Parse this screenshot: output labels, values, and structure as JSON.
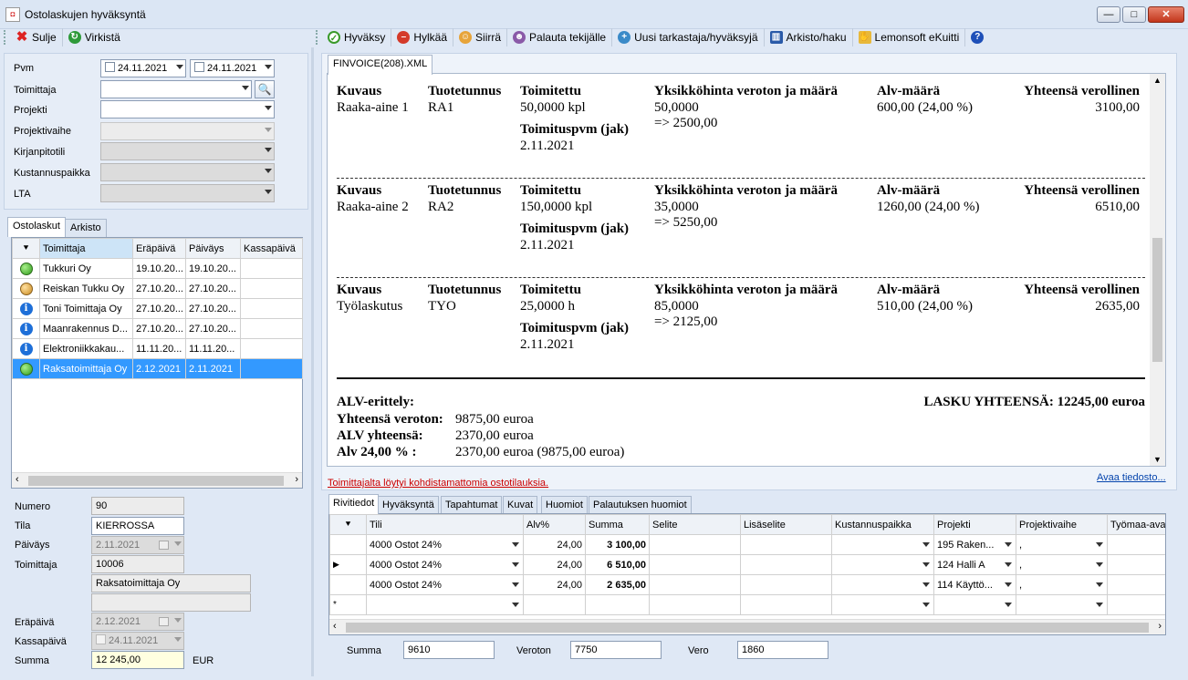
{
  "window": {
    "title": "Ostolaskujen hyväksyntä",
    "minimize": "—",
    "maximize": "□",
    "close": "✕"
  },
  "left_toolbar": {
    "close_label": "Sulje",
    "refresh_label": "Virkistä"
  },
  "right_toolbar": {
    "approve": "Hyväksy",
    "reject": "Hylkää",
    "move": "Siirrä",
    "return_to_maker": "Palauta tekijälle",
    "new_reviewer": "Uusi tarkastaja/hyväksyjä",
    "archive": "Arkisto/haku",
    "ekuitti": "Lemonsoft eKuitti",
    "help": "?"
  },
  "filters": {
    "pvm_label": "Pvm",
    "date_from": "24.11.2021",
    "date_to": "24.11.2021",
    "supplier_label": "Toimittaja",
    "project_label": "Projekti",
    "project_phase_label": "Projektivaihe",
    "account_label": "Kirjanpitotili",
    "cost_center_label": "Kustannuspaikka",
    "lta_label": "LTA"
  },
  "left_tabs": [
    "Ostolaskut",
    "Arkisto"
  ],
  "invoice_list": {
    "columns": [
      "Toimittaja",
      "Eräpäivä",
      "Päiväys",
      "Kassapäivä"
    ],
    "rows": [
      {
        "status": "green",
        "supplier": "Tukkuri Oy",
        "due": "19.10.20...",
        "date": "19.10.20...",
        "cash": ""
      },
      {
        "status": "orange",
        "supplier": "Reiskan Tukku Oy",
        "due": "27.10.20...",
        "date": "27.10.20...",
        "cash": ""
      },
      {
        "status": "info",
        "supplier": "Toni Toimittaja Oy",
        "due": "27.10.20...",
        "date": "27.10.20...",
        "cash": ""
      },
      {
        "status": "info",
        "supplier": "Maanrakennus D...",
        "due": "27.10.20...",
        "date": "27.10.20...",
        "cash": ""
      },
      {
        "status": "info",
        "supplier": "Elektroniikkakau...",
        "due": "11.11.20...",
        "date": "11.11.20...",
        "cash": ""
      },
      {
        "status": "green",
        "supplier": "Raksatoimittaja Oy",
        "due": "2.12.2021",
        "date": "2.11.2021",
        "cash": "",
        "selected": true
      }
    ]
  },
  "details": {
    "number_label": "Numero",
    "number": "90",
    "state_label": "Tila",
    "state": "KIERROSSA",
    "date_label": "Päiväys",
    "date": "2.11.2021",
    "supplier_label": "Toimittaja",
    "supplier_id": "10006",
    "supplier_name": "Raksatoimittaja Oy",
    "supplier_extra": "",
    "due_label": "Eräpäivä",
    "due": "2.12.2021",
    "cash_label": "Kassapäivä",
    "cash": "24.11.2021",
    "sum_label": "Summa",
    "sum": "12 245,00",
    "currency": "EUR"
  },
  "doc_tab": "FINVOICE(208).XML",
  "invoice_doc": {
    "headers": {
      "desc": "Kuvaus",
      "code": "Tuotetunnus",
      "delivered": "Toimitettu",
      "unit_price": "Yksikköhinta veroton ja määrä",
      "vat": "Alv-määrä",
      "total": "Yhteensä verollinen",
      "delivery_date": "Toimituspvm (jak)"
    },
    "lines": [
      {
        "desc": "Raaka-aine 1",
        "code": "RA1",
        "qty": "50,0000 kpl",
        "date": "2.11.2021",
        "price": "50,0000",
        "amount": "=> 2500,00",
        "vat": "600,00 (24,00 %)",
        "total": "3100,00"
      },
      {
        "desc": "Raaka-aine 2",
        "code": "RA2",
        "qty": "150,0000 kpl",
        "date": "2.11.2021",
        "price": "35,0000",
        "amount": "=> 5250,00",
        "vat": "1260,00 (24,00 %)",
        "total": "6510,00"
      },
      {
        "desc": "Työlaskutus",
        "code": "TYO",
        "qty": "25,0000 h",
        "date": "2.11.2021",
        "price": "85,0000",
        "amount": "=> 2125,00",
        "vat": "510,00 (24,00 %)",
        "total": "2635,00"
      }
    ],
    "vat_breakdown_label": "ALV-erittely:",
    "total_excl_label": "Yhteensä veroton:",
    "total_excl": "9875,00 euroa",
    "vat_total_label": "ALV yhteensä:",
    "vat_total": "2370,00 euroa",
    "vat24_label": "Alv 24,00 % :",
    "vat24": "2370,00 euroa (9875,00 euroa)",
    "grand_total_label": "LASKU YHTEENSÄ:",
    "grand_total": "12245,00 euroa"
  },
  "warning_link": "Toimittajalta löytyi kohdistamattomia ostotilauksia.",
  "open_file_link": "Avaa tiedosto...",
  "bottom_tabs": [
    "Rivitiedot",
    "Hyväksyntä",
    "Tapahtumat",
    "Kuvat",
    "Huomiot",
    "Palautuksen huomiot"
  ],
  "rows_grid": {
    "columns": [
      "Tili",
      "Alv%",
      "Summa",
      "Selite",
      "Lisäselite",
      "Kustannuspaikka",
      "Projekti",
      "Projektivaihe",
      "Työmaa-ava"
    ],
    "rows": [
      {
        "account": "4000 Ostot 24%",
        "vat": "24,00",
        "sum": "3 100,00",
        "project": "195 Raken...",
        "phase": ","
      },
      {
        "account": "4000 Ostot 24%",
        "vat": "24,00",
        "sum": "6 510,00",
        "project": "124 Halli A",
        "phase": ","
      },
      {
        "account": "4000 Ostot 24%",
        "vat": "24,00",
        "sum": "2 635,00",
        "project": "114 Käyttö...",
        "phase": ","
      }
    ],
    "current_marker": "▶",
    "new_marker": "*"
  },
  "totals": {
    "sum_label": "Summa",
    "sum": "9610",
    "excl_label": "Veroton",
    "excl": "7750",
    "tax_label": "Vero",
    "tax": "1860"
  }
}
